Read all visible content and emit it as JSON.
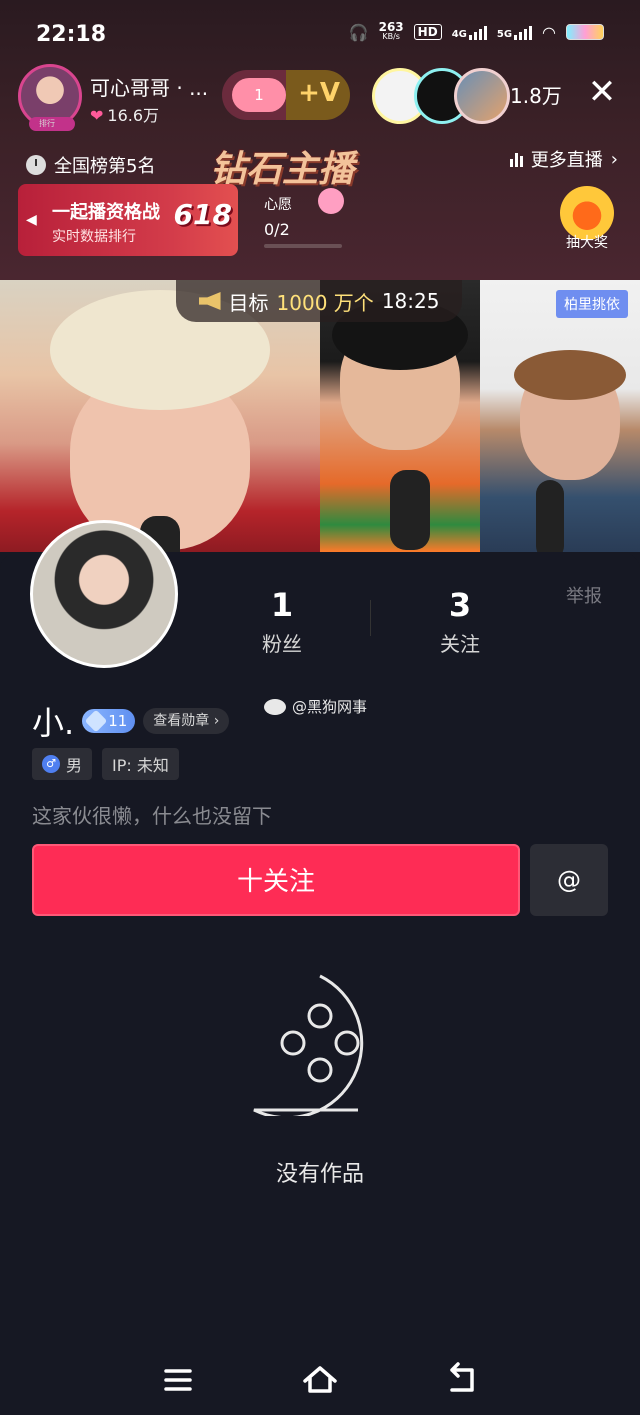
{
  "status_bar": {
    "time": "22:18",
    "net_speed": "263",
    "net_unit": "KB/s",
    "hd": "HD",
    "net_4g": "4G",
    "net_5g": "5G"
  },
  "live_header": {
    "host_name": "可心哥哥 · ...",
    "host_fans": "16.6万",
    "host_badge": "排行",
    "gift_count": "1",
    "gift_plus": "+V",
    "viewer_count": "1.8万",
    "rank_text": "全国榜第5名",
    "banner_title": "钻石主播",
    "more_live": "更多直播",
    "battle_title": "一起播资格战",
    "battle_sub": "实时数据排行",
    "battle_badge": "618",
    "wish_label": "心愿",
    "wish_count": "0/2",
    "lottery_label": "抽大奖"
  },
  "video": {
    "goal_label": "目标",
    "goal_amount": "1000 万个",
    "goal_time": "18:25",
    "tag_right": "柏里挑依"
  },
  "profile": {
    "fans_count": "1",
    "fans_label": "粉丝",
    "follow_count": "3",
    "follow_label": "关注",
    "report_label": "举报",
    "name": "小.",
    "level": "11",
    "view_badges": "查看勋章",
    "watermark": "@黑狗网事",
    "gender": "男",
    "ip": "IP: 未知",
    "bio": "这家伙很懒，什么也没留下",
    "follow_button": "十关注",
    "at_button": "@",
    "empty_text": "没有作品"
  },
  "colors": {
    "accent": "#fe2c55",
    "sheet_bg": "#161823",
    "chip_bg": "#2c2d35"
  },
  "icons": {
    "close": "close-icon",
    "clock": "clock-icon",
    "menu": "menu-icon",
    "home": "home-icon",
    "back": "back-icon"
  }
}
